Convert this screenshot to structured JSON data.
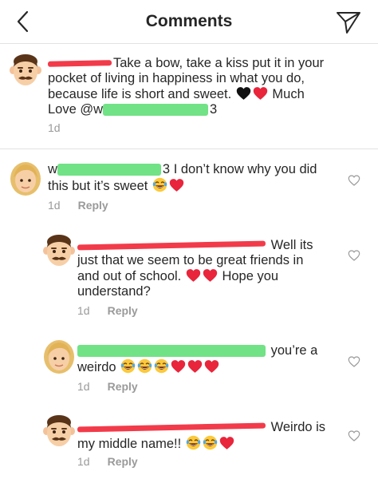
{
  "header": {
    "title": "Comments"
  },
  "caption": {
    "text_part1": "Take a bow, take a kiss put it in your",
    "text_part2": "pocket of living in happiness in what you do,",
    "text_part3": "because life is short and sweet.",
    "text_part4": "Much",
    "text_part5": "Love @w",
    "text_part6": "3",
    "time": "1d"
  },
  "comments": [
    {
      "username_visible_start": "w",
      "username_visible_end": "3",
      "text_part1": "I don’t know why you did",
      "text_part2": "this but it’s sweet",
      "time": "1d",
      "reply": "Reply"
    },
    {
      "text_part1": "Well its",
      "text_part2": "just that we seem to be great friends in",
      "text_part3": "and out of school.",
      "text_part4": "Hope you",
      "text_part5": "understand?",
      "time": "1d",
      "reply": "Reply"
    },
    {
      "text_part1": "you’re a",
      "text_part2": "weirdo",
      "time": "1d",
      "reply": "Reply"
    },
    {
      "text_part1": "Weirdo is",
      "text_part2": "my middle name!!",
      "time": "1d",
      "reply": "Reply"
    }
  ],
  "icons": {
    "back": "chevron-left-icon",
    "send": "paper-plane-icon",
    "like": "heart-outline-icon"
  },
  "colors": {
    "red_redaction": "#f23b4a",
    "green_redaction": "#69e07f",
    "meta_gray": "#9a9a9a",
    "heart_red": "#e8253b"
  }
}
